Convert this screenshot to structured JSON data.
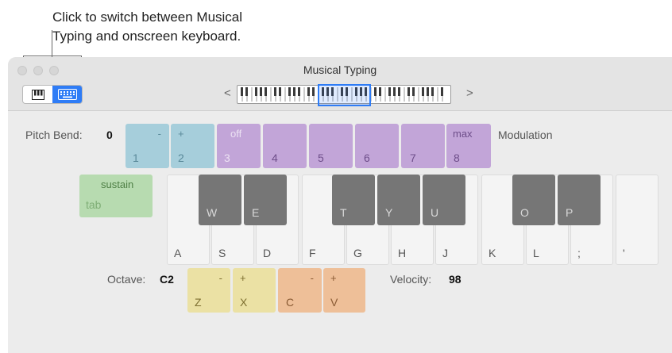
{
  "callout": {
    "line1": "Click to switch between Musical",
    "line2": "Typing and onscreen keyboard."
  },
  "window": {
    "title": "Musical Typing",
    "mode_switch": {
      "options": [
        {
          "icon": "piano-keyboard-icon",
          "active": false
        },
        {
          "icon": "computer-keyboard-icon",
          "active": true
        }
      ]
    },
    "range": {
      "prev_glyph": "<",
      "next_glyph": ">"
    }
  },
  "pitch_bend": {
    "label": "Pitch Bend:",
    "value": "0"
  },
  "modulation_label": "Modulation",
  "number_keys": [
    {
      "top": "-",
      "bottom": "1",
      "color": "blue"
    },
    {
      "top": "+",
      "bottom": "2",
      "color": "blue"
    },
    {
      "top": "off",
      "bottom": "3",
      "color": "purple"
    },
    {
      "top": "",
      "bottom": "4",
      "color": "purple"
    },
    {
      "top": "",
      "bottom": "5",
      "color": "purple"
    },
    {
      "top": "",
      "bottom": "6",
      "color": "purple"
    },
    {
      "top": "",
      "bottom": "7",
      "color": "purple"
    },
    {
      "top": "max",
      "bottom": "8",
      "color": "purple"
    }
  ],
  "sustain_key": {
    "top": "sustain",
    "bottom": "tab"
  },
  "white_keys": [
    "A",
    "S",
    "D",
    "F",
    "G",
    "H",
    "J",
    "K",
    "L",
    ";",
    "'"
  ],
  "black_keys": [
    "W",
    "E",
    "T",
    "Y",
    "U",
    "O",
    "P"
  ],
  "octave": {
    "label": "Octave:",
    "value": "C2"
  },
  "octave_keys": [
    {
      "top": "-",
      "bottom": "Z"
    },
    {
      "top": "+",
      "bottom": "X"
    }
  ],
  "velocity_keys": [
    {
      "top": "-",
      "bottom": "C"
    },
    {
      "top": "+",
      "bottom": "V"
    }
  ],
  "velocity": {
    "label": "Velocity:",
    "value": "98"
  },
  "colors": {
    "accent": "#2e7cf6",
    "pitch_key": "#a6cedb",
    "modulation_key": "#c2a5d8",
    "sustain_key": "#b7dbb0",
    "octave_key": "#ebe1a4",
    "velocity_key": "#eebf98",
    "black_key": "#767676"
  }
}
